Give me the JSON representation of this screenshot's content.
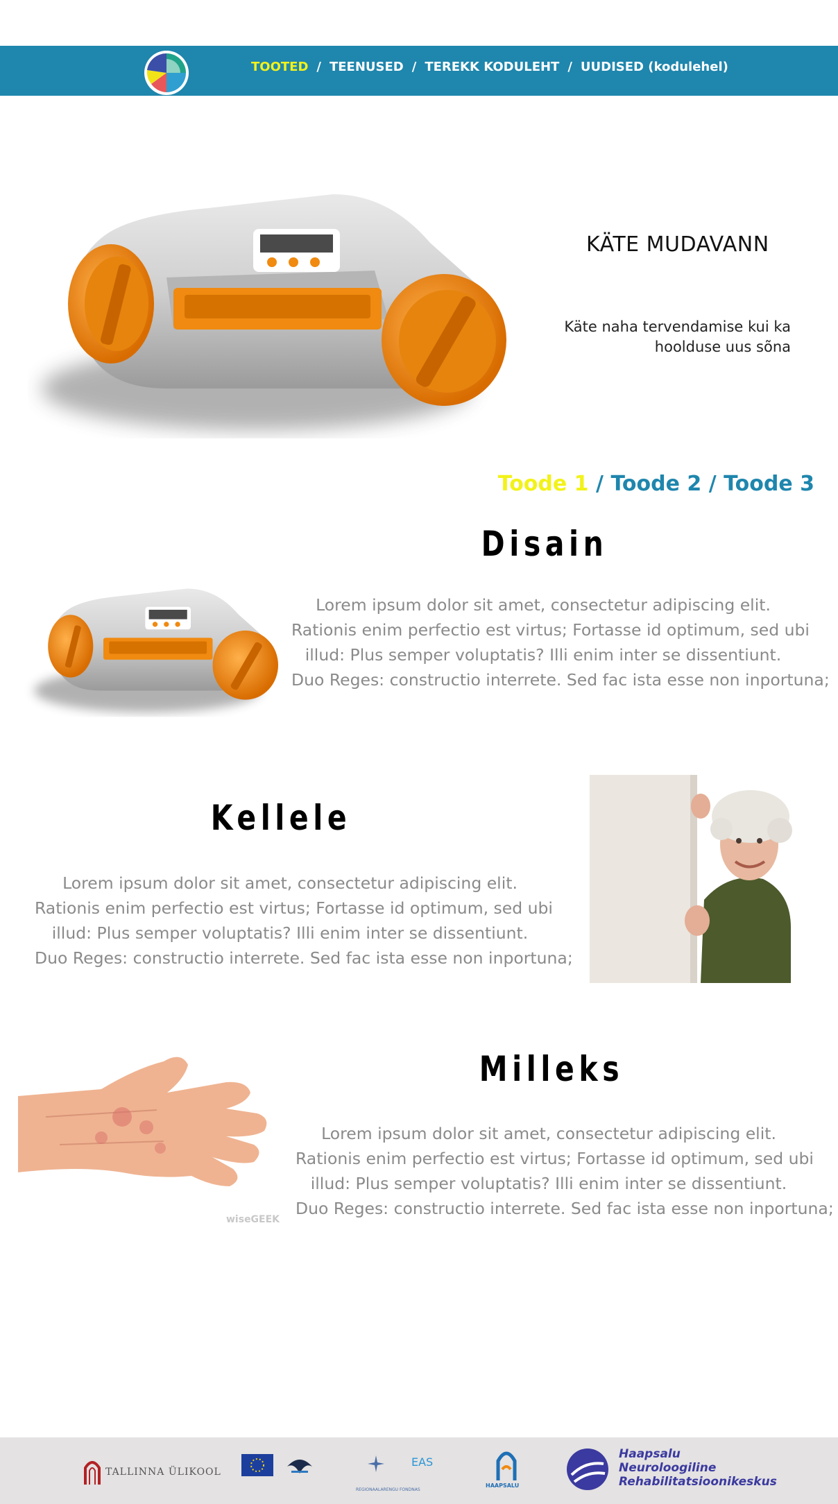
{
  "nav": {
    "items": [
      {
        "label": "TOOTED",
        "active": true
      },
      {
        "label": "TEENUSED",
        "active": false
      },
      {
        "label": "TEREKK KODULEHT",
        "active": false
      },
      {
        "label": "UUDISED (kodulehel)",
        "active": false
      }
    ],
    "separator": "/"
  },
  "hero": {
    "title": "KÄTE MUDAVANN",
    "subtitle_line1": "Käte naha tervendamise kui ka",
    "subtitle_line2": "hoolduse uus sõna"
  },
  "product_tabs": {
    "items": [
      "Toode 1",
      "Toode 2",
      "Toode 3"
    ],
    "separator": "/",
    "active_color": "#f2f21a",
    "color": "#1f86ad"
  },
  "sections": [
    {
      "title": "Disain",
      "lines": [
        "Lorem ipsum dolor sit amet, consectetur adipiscing elit.",
        "Rationis enim perfectio est virtus; Fortasse id optimum, sed ubi",
        "illud: Plus semper voluptatis? Illi enim inter se dissentiunt.",
        "Duo Reges: constructio interrete. Sed fac ista esse non inportuna;"
      ]
    },
    {
      "title": "Kellele",
      "lines": [
        "Lorem ipsum dolor sit amet, consectetur adipiscing elit.",
        "Rationis enim perfectio est virtus; Fortasse id optimum, sed ubi",
        "illud: Plus semper voluptatis? Illi enim inter se dissentiunt.",
        "Duo Reges: constructio interrete. Sed fac ista esse non inportuna;"
      ]
    },
    {
      "title": "Milleks",
      "lines": [
        "Lorem ipsum dolor sit amet, consectetur adipiscing elit.",
        "Rationis enim perfectio est virtus; Fortasse id optimum, sed ubi",
        "illud: Plus semper voluptatis? Illi enim inter se dissentiunt.",
        "Duo Reges: constructio interrete. Sed fac ista esse non inportuna;"
      ]
    }
  ],
  "images": {
    "hand_watermark": "wiseGEEK"
  },
  "footer": {
    "tlu": "TALLINNA ÜLIKOOL",
    "eas": "EAS",
    "regional": "REGIONAALARENGU FONDNAS",
    "haapsalu": "HAAPSALU",
    "hnrk_line1": "Haapsalu",
    "hnrk_line2": "Neuroloogiline",
    "hnrk_line3": "Rehabilitatsioonikeskus"
  },
  "colors": {
    "nav_bg": "#1f86ad",
    "nav_active": "#f2f21a",
    "device_orange": "#f08a10",
    "footer_bg": "#e4e2e2"
  }
}
